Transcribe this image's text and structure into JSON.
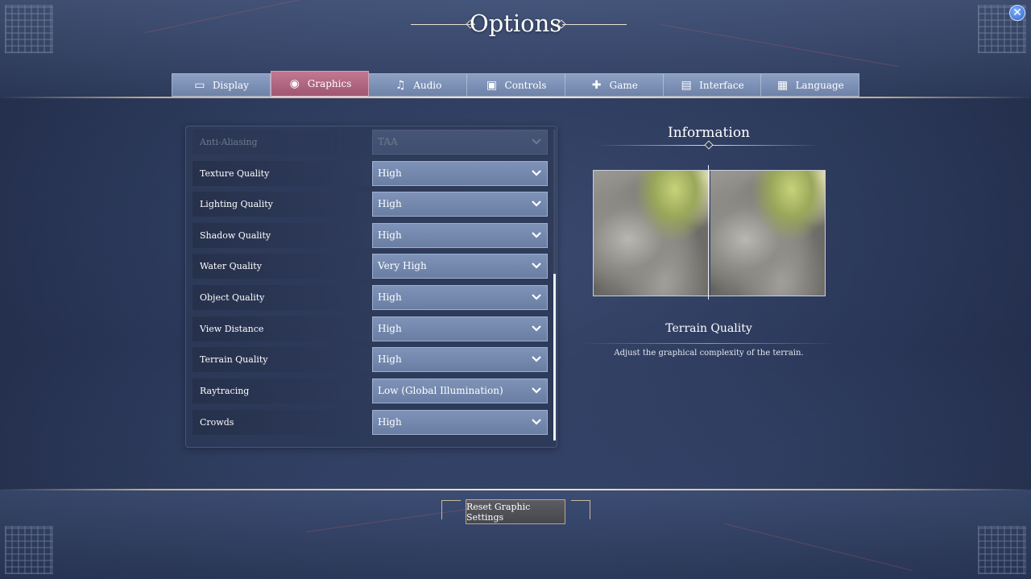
{
  "header": {
    "title": "Options",
    "close_icon": "close-icon"
  },
  "tabs": [
    {
      "label": "Display",
      "icon": "monitor-icon",
      "active": false
    },
    {
      "label": "Graphics",
      "icon": "eye-icon",
      "active": true
    },
    {
      "label": "Audio",
      "icon": "music-note-icon",
      "active": false
    },
    {
      "label": "Controls",
      "icon": "controls-icon",
      "active": false
    },
    {
      "label": "Game",
      "icon": "puzzle-icon",
      "active": false
    },
    {
      "label": "Interface",
      "icon": "interface-icon",
      "active": false
    },
    {
      "label": "Language",
      "icon": "language-icon",
      "active": false
    }
  ],
  "settings": [
    {
      "label": "Anti-Aliasing",
      "value": "TAA"
    },
    {
      "label": "Texture Quality",
      "value": "High"
    },
    {
      "label": "Lighting Quality",
      "value": "High"
    },
    {
      "label": "Shadow Quality",
      "value": "High"
    },
    {
      "label": "Water Quality",
      "value": "Very High"
    },
    {
      "label": "Object Quality",
      "value": "High"
    },
    {
      "label": "View Distance",
      "value": "High"
    },
    {
      "label": "Terrain Quality",
      "value": "High"
    },
    {
      "label": "Raytracing",
      "value": "Low (Global Illumination)"
    },
    {
      "label": "Crowds",
      "value": "High"
    }
  ],
  "info": {
    "title": "Information",
    "setting_name": "Terrain Quality",
    "description": "Adjust the graphical complexity of the terrain."
  },
  "footer": {
    "reset_label": "Reset Graphic Settings"
  },
  "colors": {
    "accent_active_tab": "#b0647f",
    "tab_bar": "#7d91b6",
    "background": "#2f3d5f",
    "close_button": "#3a76e0"
  }
}
